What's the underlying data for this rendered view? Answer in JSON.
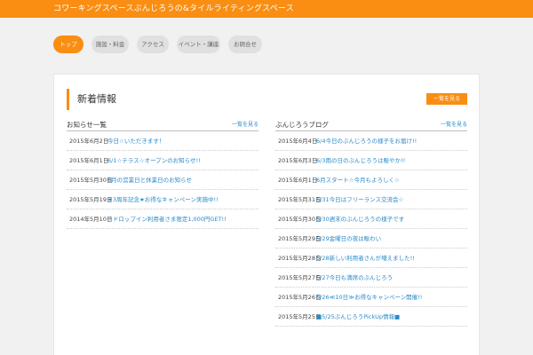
{
  "header": {
    "site_title": "コワーキングスペースぶんじろうの&タイルライティングスペース"
  },
  "nav": {
    "items": [
      {
        "label": "トップ",
        "active": true
      },
      {
        "label": "施設・料金",
        "active": false
      },
      {
        "label": "アクセス",
        "active": false
      },
      {
        "label": "イベント・講座",
        "active": false
      },
      {
        "label": "お問合せ",
        "active": false
      }
    ]
  },
  "main": {
    "section_title": "新着情報",
    "top_button_label": "一覧を見る"
  },
  "news": {
    "title": "お知らせ一覧",
    "more_label": "一覧を見る",
    "items": [
      {
        "date": "2015年6月2日",
        "title": "今日☆いただきます！"
      },
      {
        "date": "2015年6月1日",
        "title": "6/1☆テラス☆オープンのお知らせ!!"
      },
      {
        "date": "2015年5月30日",
        "title": "6月の営業日と休業日のお知らせ"
      },
      {
        "date": "2015年5月19日",
        "title": "★3周年記念★お得なキャンペーン実施中!!"
      },
      {
        "date": "2014年5月10日",
        "title": "☆ドロップイン利用者さま限定1,000円GET!!"
      }
    ]
  },
  "blog": {
    "title": "ぶんじろうブログ",
    "more_label": "一覧を見る",
    "items": [
      {
        "date": "2015年6月4日",
        "title": "6/4今日のぶんじろうの様子をお届け!!"
      },
      {
        "date": "2015年6月3日",
        "title": "6/3雨の日のぶんじろうは賑やか!!"
      },
      {
        "date": "2015年6月1日",
        "title": "6月スタート☆今月もよろしく☆"
      },
      {
        "date": "2015年5月31日",
        "title": "5/31今日はフリーランス交流会☆"
      },
      {
        "date": "2015年5月30日",
        "title": "5/30週末のぶんじろうの様子です"
      },
      {
        "date": "2015年5月29日",
        "title": "5/29金曜日の夜は賑わい"
      },
      {
        "date": "2015年5月28日",
        "title": "5/28新しい利用者さんが増えました!!"
      },
      {
        "date": "2015年5月27日",
        "title": "5/27今日も満席のぶんじろう"
      },
      {
        "date": "2015年5月26日",
        "title": "5/26≪10日≫お得なキャンペーン開催!!"
      },
      {
        "date": "2015年5月25日",
        "title": "■5/25ぶんじろうPickUp情報■"
      }
    ]
  }
}
